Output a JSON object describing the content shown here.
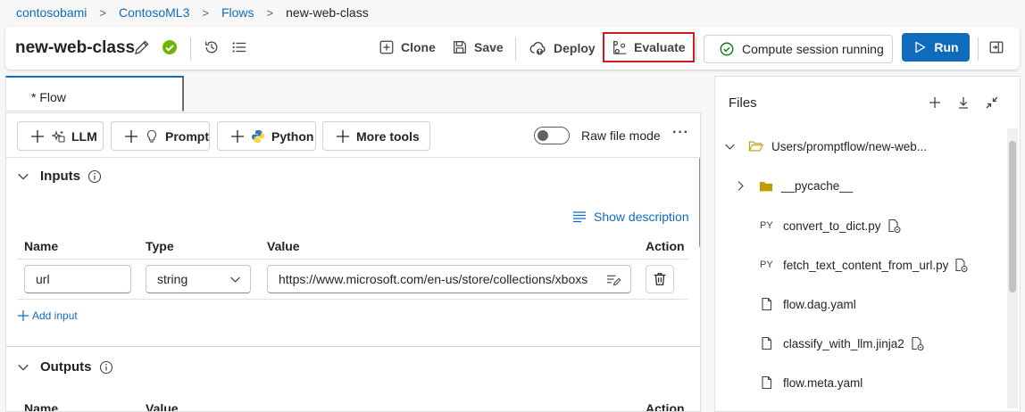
{
  "breadcrumb": {
    "items": [
      "contosobami",
      "ContosoML3",
      "Flows"
    ],
    "current": "new-web-class"
  },
  "header": {
    "title": "new-web-class",
    "clone_label": "Clone",
    "save_label": "Save",
    "deploy_label": "Deploy",
    "evaluate_label": "Evaluate",
    "compute_status": "Compute session running",
    "run_label": "Run",
    "accent_color": "#0f6cbd",
    "status_color": "#107c10",
    "highlight_color": "#d01a1e"
  },
  "tabs": [
    {
      "label": "* Flow"
    }
  ],
  "toolbar": {
    "llm_label": "LLM",
    "prompt_label": "Prompt",
    "python_label": "Python",
    "more_tools_label": "More tools",
    "raw_file_mode_label": "Raw file mode",
    "raw_file_mode_on": false,
    "overflow_label": "···"
  },
  "inputs": {
    "title": "Inputs",
    "show_description": "Show description",
    "columns": [
      "Name",
      "Type",
      "Value",
      "Action"
    ],
    "rows": [
      {
        "name": "url",
        "type": "string",
        "value": "https://www.microsoft.com/en-us/store/collections/xboxs"
      }
    ],
    "add_input": "Add input"
  },
  "outputs": {
    "title": "Outputs",
    "columns": [
      "Name",
      "Value",
      "Action"
    ]
  },
  "files": {
    "title": "Files",
    "root": "Users/promptflow/new-web...",
    "items": [
      {
        "label": "__pycache__",
        "kind": "folder",
        "prefix": ""
      },
      {
        "label": "convert_to_dict.py",
        "kind": "python",
        "prefix": "PY"
      },
      {
        "label": "fetch_text_content_from_url.py",
        "kind": "python",
        "prefix": "PY"
      },
      {
        "label": "flow.dag.yaml",
        "kind": "file",
        "prefix": ""
      },
      {
        "label": "classify_with_llm.jinja2",
        "kind": "file",
        "prefix": ""
      },
      {
        "label": "flow.meta.yaml",
        "kind": "file",
        "prefix": ""
      }
    ]
  },
  "icons": [
    "pencil-icon",
    "check-circle-icon",
    "history-icon",
    "list-icon",
    "clone-icon",
    "save-icon",
    "deploy-icon",
    "evaluate-icon",
    "play-icon",
    "panel-toggle-icon",
    "plus-icon",
    "llm-icon",
    "bulb-icon",
    "python-icon",
    "chevron-down-icon",
    "info-icon",
    "description-icon",
    "edit-value-icon",
    "trash-icon",
    "download-icon",
    "collapse-icon",
    "folder-open-icon",
    "folder-icon",
    "file-icon",
    "file-link-icon",
    "chevron-right-icon"
  ]
}
